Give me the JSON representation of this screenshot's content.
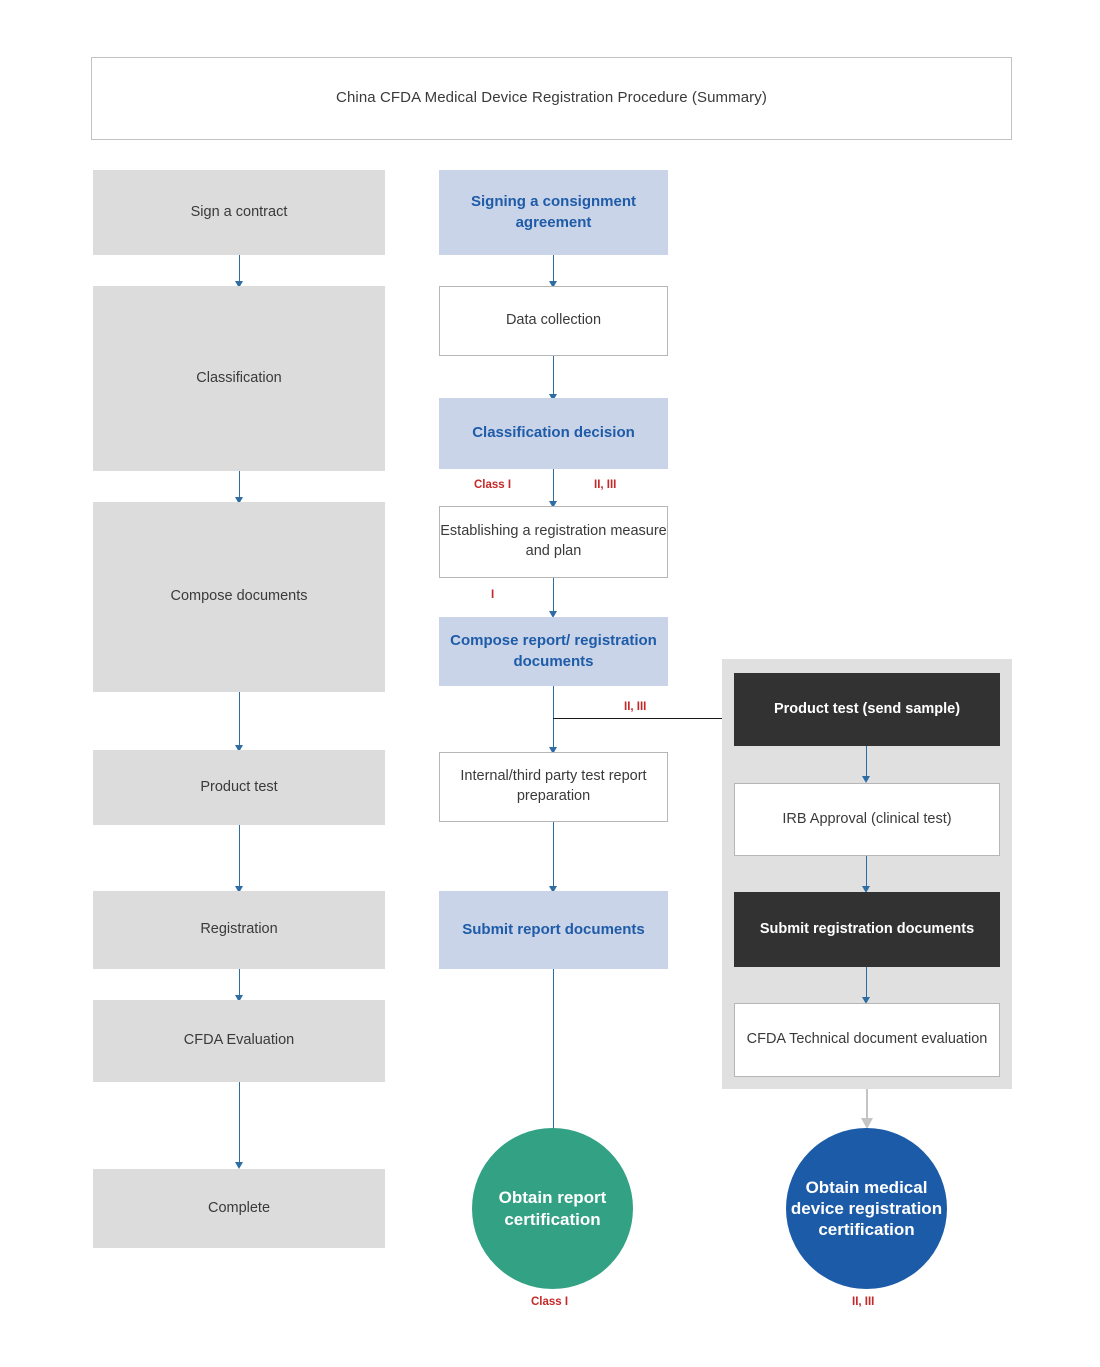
{
  "header": {
    "title": "China CFDA Medical Device Registration Procedure (Summary)"
  },
  "left_column": {
    "name": "overview-steps",
    "steps": [
      {
        "label": "Sign a contract"
      },
      {
        "label": "Classification"
      },
      {
        "label": "Compose documents"
      },
      {
        "label": "Product test"
      },
      {
        "label": "Registration"
      },
      {
        "label": "CFDA Evaluation"
      },
      {
        "label": "Complete"
      }
    ]
  },
  "middle_column": {
    "name": "detailed-procedure",
    "steps": [
      {
        "label": "Signing a consignment agreement",
        "style": "blue"
      },
      {
        "label": "Data collection",
        "style": "white"
      },
      {
        "label": "Classification decision",
        "style": "blue"
      },
      {
        "label": "Establishing a registration measure and plan",
        "style": "white"
      },
      {
        "label": "Compose report/ registration documents",
        "style": "blue"
      },
      {
        "label": "Internal/third party test report preparation",
        "style": "white"
      },
      {
        "label": "Submit report documents",
        "style": "blue"
      }
    ]
  },
  "right_group": {
    "name": "class-ii-iii-track",
    "steps": [
      {
        "label": "Product test (send sample)",
        "style": "dark"
      },
      {
        "label": "IRB Approval (clinical test)",
        "style": "white"
      },
      {
        "label": "Submit registration documents",
        "style": "dark"
      },
      {
        "label": "CFDA Technical document evaluation",
        "style": "white"
      }
    ]
  },
  "outcomes": [
    {
      "label": "Obtain report certification",
      "caption": "Class  I",
      "color": "#32a184"
    },
    {
      "label": "Obtain medical device registration certification",
      "caption": "II, III",
      "color": "#1c5ba8"
    }
  ],
  "branch_labels": {
    "classification_left": "Class  I",
    "classification_right": "II, III",
    "establishing_left": "I",
    "compose_right": "II, III"
  },
  "colors": {
    "accent_blue": "#1e5ba8",
    "light_blue_fill": "#c9d4e8",
    "gray_fill": "#dcdcdc",
    "dark_fill": "#323232",
    "panel_fill": "#e0e0e0",
    "branch_red": "#c62828",
    "green": "#32a184",
    "connector_blue": "#2e6da4"
  }
}
